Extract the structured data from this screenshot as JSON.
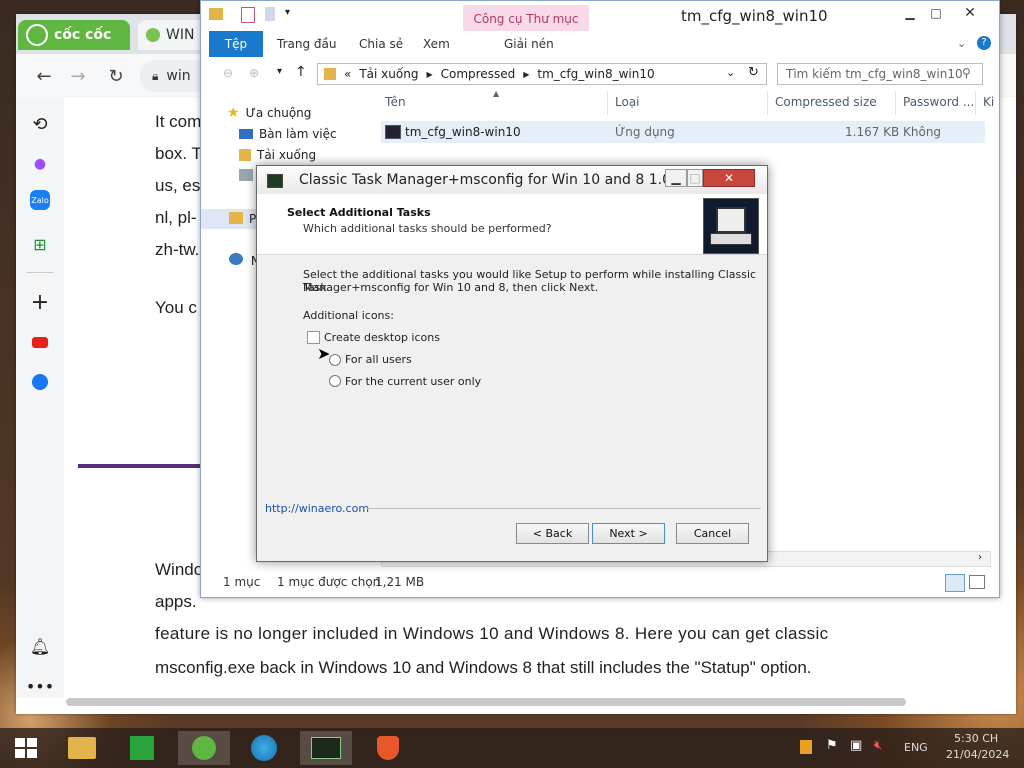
{
  "browser": {
    "tabs": [
      {
        "label": "cốc cốc"
      },
      {
        "label": "WIN"
      }
    ],
    "address_text": "win",
    "page": {
      "line1": "It com",
      "line2": "box. T",
      "line3": "us, es",
      "line4": "nl, pl-",
      "line5": "zh-tw.",
      "line6": "You c",
      "line7": "Windo",
      "line8": "apps.",
      "line9": "feature is no longer included in Windows 10 and Windows 8. Here you can get classic",
      "line10": "msconfig.exe back in Windows 10 and Windows 8 that still includes the \"Statup\" option."
    }
  },
  "explorer": {
    "title": "tm_cfg_win8_win10",
    "context_tab_group": "Công cụ Thư mục Nén",
    "ribbon_tabs": [
      "Tệp",
      "Trang đầu",
      "Chia sẻ",
      "Xem",
      "Giải nén"
    ],
    "breadcrumb": [
      "«",
      "Tải xuống",
      "Compressed",
      "tm_cfg_win8_win10"
    ],
    "search_placeholder": "Tìm kiếm tm_cfg_win8_win10",
    "nav": [
      {
        "label": "Ưa chuộng"
      },
      {
        "label": "Bàn làm việc"
      },
      {
        "label": "Tải xuống"
      },
      {
        "label": "P"
      },
      {
        "label": "N"
      }
    ],
    "columns": [
      "Tên",
      "Loại",
      "Compressed size",
      "Password ...",
      "Ki"
    ],
    "file": {
      "name": "tm_cfg_win8-win10",
      "type": "Ứng dụng",
      "size": "1.167 KB",
      "password": "Không"
    },
    "status": {
      "count": "1 mục",
      "selected": "1 mục được chọn",
      "size": "1,21 MB"
    }
  },
  "dialog": {
    "title": "Classic Task Manager+msconfig for Win 10 and 8 1.0",
    "header_title": "Select Additional Tasks",
    "header_subtitle": "Which additional tasks should be performed?",
    "description_line1": "Select the additional tasks you would like Setup to perform while installing Classic Task",
    "description_line2": "Manager+msconfig for Win 10 and 8, then click Next.",
    "group_label": "Additional icons:",
    "checkbox_label": "Create desktop icons",
    "checkbox_checked": false,
    "radio_all_users": "For all users",
    "radio_current_user": "For the current user only",
    "link": "http://winaero.com",
    "back_button": "< Back",
    "next_button": "Next >",
    "cancel_button": "Cancel"
  },
  "taskbar": {
    "language": "ENG",
    "time": "5:30 CH",
    "date": "21/04/2024"
  }
}
